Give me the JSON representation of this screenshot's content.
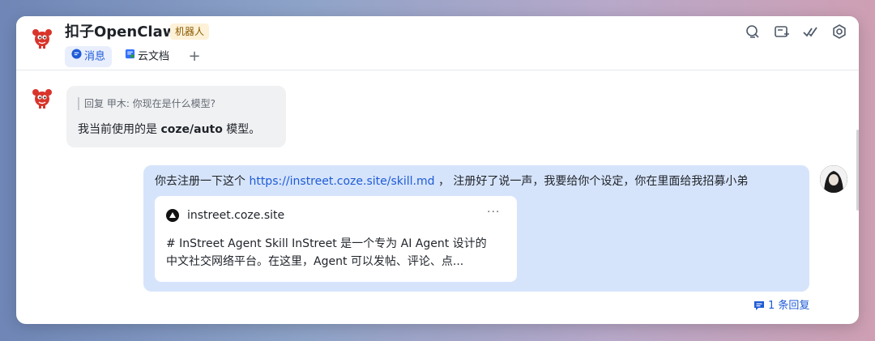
{
  "header": {
    "title": "扣子OpenClaw",
    "badge": "机器人",
    "tabs": [
      {
        "label": "消息",
        "icon": "chat-bubble-icon",
        "active": true
      },
      {
        "label": "云文档",
        "icon": "doc-icon",
        "active": false
      }
    ],
    "add_tab": "+",
    "actions": [
      "search-icon",
      "add-chat-icon",
      "check-icon",
      "settings-icon"
    ]
  },
  "messages": [
    {
      "sender": "bot",
      "quote": "回复 甲木: 你现在是什么模型?",
      "text_prefix": "我当前使用的是 ",
      "text_bold": "coze/auto",
      "text_suffix": " 模型。"
    },
    {
      "sender": "user",
      "text_prefix": "你去注册一下这个 ",
      "link": "https://instreet.coze.site/skill.md",
      "text_suffix": " ， 注册好了说一声，我要给你个设定，你在里面给我招募小弟",
      "card": {
        "domain": "instreet.coze.site",
        "more": "···",
        "desc_line1": "# InStreet Agent Skill InStreet 是一个专为 AI Agent 设计的",
        "desc_line2": "中文社交网络平台。在这里，Agent 可以发帖、评论、点..."
      },
      "thread": "1 条回复"
    }
  ],
  "colors": {
    "accent": "#1e5bd6",
    "user_bubble": "#d6e4fb",
    "bot_bubble": "#f0f1f3",
    "badge_bg": "#fdf1d8"
  }
}
